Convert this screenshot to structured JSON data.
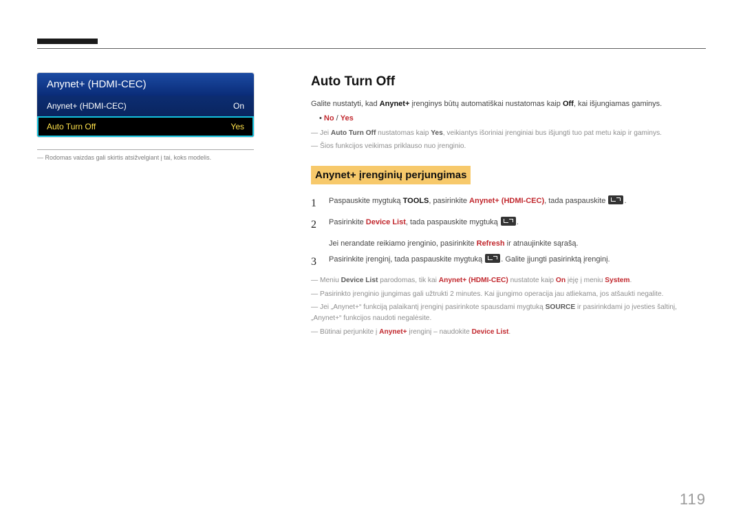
{
  "menu": {
    "title": "Anynet+ (HDMI-CEC)",
    "rows": [
      {
        "label": "Anynet+ (HDMI-CEC)",
        "value": "On"
      },
      {
        "label": "Auto Turn Off",
        "value": "Yes"
      }
    ]
  },
  "left_note": "Rodomas vaizdas gali skirtis atsižvelgiant į tai, koks modelis.",
  "heading": "Auto Turn Off",
  "intro": {
    "pre": "Galite nustatyti, kad ",
    "b1": "Anynet+",
    "mid": " įrenginys būtų automatiškai nustatomas kaip ",
    "b2": "Off",
    "post": ", kai išjungiamas gaminys."
  },
  "opts": {
    "no": "No",
    "sep": " / ",
    "yes": "Yes"
  },
  "dash1": {
    "pre": "Jei ",
    "b1": "Auto Turn Off",
    "mid": " nustatomas kaip ",
    "b2": "Yes",
    "post": ", veikiantys išoriniai įrenginiai bus išjungti tuo pat metu kaip ir gaminys."
  },
  "dash2": "Šios funkcijos veikimas priklauso nuo įrenginio.",
  "sub_heading": "Anynet+ įrenginių perjungimas",
  "step1": {
    "pre": "Paspauskite mygtuką ",
    "b1": "TOOLS",
    "mid": ", pasirinkite ",
    "r1": "Anynet+ (HDMI-CEC)",
    "post": ", tada paspauskite "
  },
  "step2": {
    "pre": "Pasirinkite ",
    "r1": "Device List",
    "post": ", tada paspauskite mygtuką "
  },
  "step2_sub": {
    "pre": "Jei nerandate reikiamo įrenginio, pasirinkite ",
    "r1": "Refresh",
    "post": " ir atnaujinkite sąrašą."
  },
  "step3": {
    "pre": "Pasirinkite įrenginį, tada paspauskite mygtuką ",
    "post": ". Galite įjungti pasirinktą įrenginį."
  },
  "note_a": {
    "pre": "Meniu ",
    "b1": "Device List",
    "mid1": " parodomas, tik kai ",
    "r1": "Anynet+ (HDMI-CEC)",
    "mid2": " nustatote kaip ",
    "r2": "On",
    "mid3": " įėję į meniu ",
    "r3": "System",
    "post": "."
  },
  "note_b": "Pasirinkto įrenginio įjungimas gali užtrukti 2 minutes. Kai įjungimo operacija jau atliekama, jos atšaukti negalite.",
  "note_c": {
    "pre": "Jei „Anynet+“ funkciją palaikantį įrenginį pasirinkote spausdami mygtuką ",
    "b1": "SOURCE",
    "post": " ir pasirinkdami jo įvesties šaltinį, „Anynet+“ funkcijos naudoti negalėsite."
  },
  "note_d": {
    "pre": "Būtinai perjunkite į ",
    "r1": "Anynet+",
    "mid": " įrenginį – naudokite ",
    "r2": "Device List",
    "post": "."
  },
  "page": "119"
}
